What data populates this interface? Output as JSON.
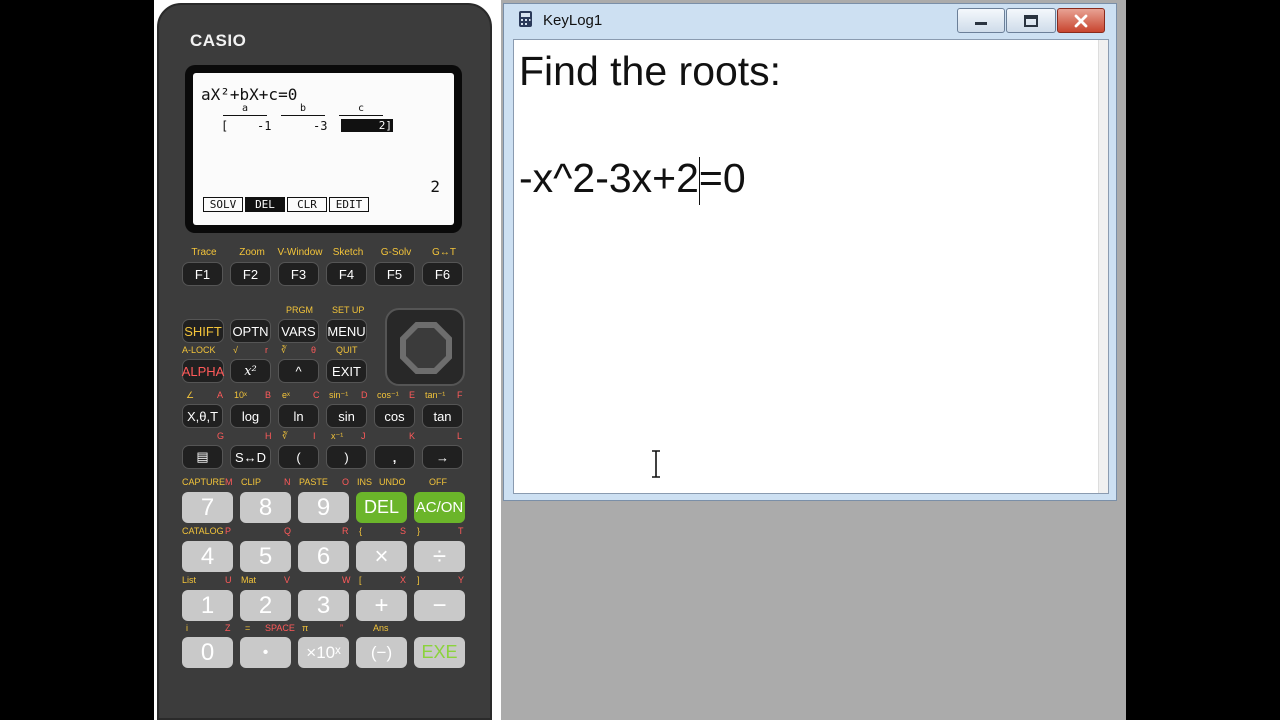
{
  "window": {
    "title": "KeyLog1"
  },
  "document": {
    "heading": "Find the roots:",
    "equation_before_caret": "-x^2-3x+",
    "equation_after_caret": "2=0"
  },
  "calculator": {
    "brand": "CASIO",
    "screen": {
      "equation": "aX²+bX+c=0",
      "headers": [
        "a",
        "b",
        "c"
      ],
      "cells": [
        "[",
        "-1",
        "-3",
        "2]"
      ],
      "selected_value": "2",
      "menu": [
        "SOLV",
        "DEL",
        "CLR",
        "EDIT"
      ]
    },
    "fkey_labels": [
      "Trace",
      "Zoom",
      "V-Window",
      "Sketch",
      "G-Solv",
      "G↔T"
    ],
    "fkeys": [
      "F1",
      "F2",
      "F3",
      "F4",
      "F5",
      "F6"
    ],
    "row1": {
      "keys": [
        "SHIFT",
        "OPTN",
        "VARS",
        "MENU"
      ],
      "above": [
        "PRGM",
        "SET UP"
      ]
    },
    "row2": {
      "keys": [
        "ALPHA",
        "x²",
        "^",
        "EXIT"
      ],
      "above": [
        "A-LOCK",
        "√",
        "r",
        "∛",
        "θ",
        "QUIT"
      ]
    },
    "row3": {
      "keys": [
        "X,θ,T",
        "log",
        "ln",
        "sin",
        "cos",
        "tan"
      ],
      "above": [
        "∠",
        "A",
        "10ˣ",
        "B",
        "eˣ",
        "C",
        "sin⁻¹",
        "D",
        "cos⁻¹",
        "E",
        "tan⁻¹",
        "F"
      ]
    },
    "row4": {
      "keys": [
        "▤",
        "S↔D",
        "(",
        ")",
        ",",
        "→"
      ],
      "above": [
        "G",
        "H",
        "∛",
        "I",
        "x⁻¹",
        "J",
        "K",
        "L"
      ]
    },
    "row5": {
      "keys": [
        "7",
        "8",
        "9",
        "DEL",
        "AC/ON"
      ],
      "above": [
        "CAPTURE",
        "M",
        "CLIP",
        "N",
        "PASTE",
        "O",
        "INS",
        "UNDO",
        "OFF"
      ]
    },
    "row6": {
      "keys": [
        "4",
        "5",
        "6",
        "×",
        "÷"
      ],
      "above": [
        "CATALOG",
        "P",
        "Q",
        "R",
        "{",
        "S",
        "}",
        "T"
      ]
    },
    "row7": {
      "keys": [
        "1",
        "2",
        "3",
        "+",
        "−"
      ],
      "above": [
        "List",
        "U",
        "Mat",
        "V",
        "W",
        "[",
        "X",
        "]",
        "Y"
      ]
    },
    "row8": {
      "keys": [
        "0",
        "•",
        "×10ˣ",
        "(−)",
        "EXE"
      ],
      "above": [
        "i",
        "Z",
        "=",
        "SPACE",
        "π",
        "”",
        "Ans"
      ]
    },
    "colors": {
      "body": "#3c3c3c",
      "accent_yellow": "#f3c43a",
      "accent_red": "#ff5a5a",
      "green_key": "#6bb52a"
    }
  }
}
